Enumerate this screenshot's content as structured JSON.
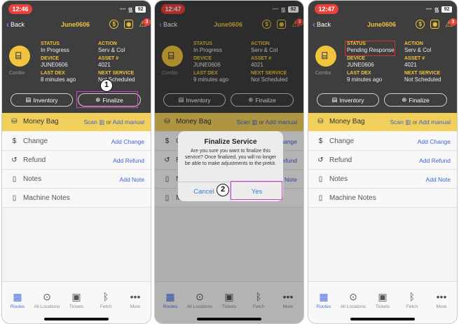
{
  "panels": [
    {
      "time": "12:46",
      "battery": "92",
      "nav": {
        "back": "Back",
        "title": "June0606",
        "alert_count": "3"
      },
      "header": {
        "combo": "Combo",
        "status_label": "STATUS",
        "status_value": "In Progress",
        "action_label": "ACTION",
        "action_value": "Serv & Col",
        "device_label": "DEVICE",
        "device_value": "JUNE0606",
        "asset_label": "ASSET #",
        "asset_value": "4021",
        "lastdex_label": "LAST DEX",
        "lastdex_value": "8 minutes ago",
        "nextservice_label": "NEXT SERVICE",
        "nextservice_value": "Not Scheduled",
        "inventory_button": "Inventory",
        "finalize_button": "Finalize"
      },
      "callout": "1"
    },
    {
      "time": "12:47",
      "battery": "92",
      "nav": {
        "back": "Back",
        "title": "June0606",
        "alert_count": "3"
      },
      "header": {
        "combo": "Combo",
        "status_label": "STATUS",
        "status_value": "In Progress",
        "action_label": "ACTION",
        "action_value": "Serv & Col",
        "device_label": "DEVICE",
        "device_value": "JUNE0606",
        "asset_label": "ASSET #",
        "asset_value": "4021",
        "lastdex_label": "LAST DEX",
        "lastdex_value": "9 minutes ago",
        "nextservice_label": "NEXT SERVICE",
        "nextservice_value": "Not Scheduled",
        "inventory_button": "Inventory",
        "finalize_button": "Finalize"
      },
      "dialog": {
        "title": "Finalize Service",
        "message": "Are you sure you want to finalize this service? Once finalized, you will no longer be able to make adjustments to the prekit.",
        "cancel": "Cancel",
        "confirm": "Yes"
      },
      "callout": "2"
    },
    {
      "time": "12:47",
      "battery": "92",
      "nav": {
        "back": "Back",
        "title": "June0606",
        "alert_count": "3"
      },
      "header": {
        "combo": "Combo",
        "status_label": "STATUS",
        "status_value": "Pending Response",
        "action_label": "ACTION",
        "action_value": "Serv & Col",
        "device_label": "DEVICE",
        "device_value": "JUNE0606",
        "asset_label": "ASSET #",
        "asset_value": "4021",
        "lastdex_label": "LAST DEX",
        "lastdex_value": "9 minutes ago",
        "nextservice_label": "NEXT SERVICE",
        "nextservice_value": "Not Scheduled",
        "inventory_button": "Inventory",
        "finalize_button": "Finalize"
      }
    }
  ],
  "list": {
    "money_bag": "Money Bag",
    "scan": "Scan",
    "or": "or",
    "add_manual": "Add manual",
    "change": "Change",
    "add_change": "Add Change",
    "refund": "Refund",
    "add_refund": "Add Refund",
    "notes": "Notes",
    "add_note": "Add Note",
    "machine_notes": "Machine Notes"
  },
  "tabs": [
    "Routes",
    "All Locations",
    "Tickets",
    "Fetch",
    "More"
  ],
  "colors": {
    "accent": "#f0c43c",
    "header_bg": "#3e3e3e",
    "link": "#3c63d6",
    "highlight": "#d63bd6",
    "alert": "#e8423c"
  }
}
